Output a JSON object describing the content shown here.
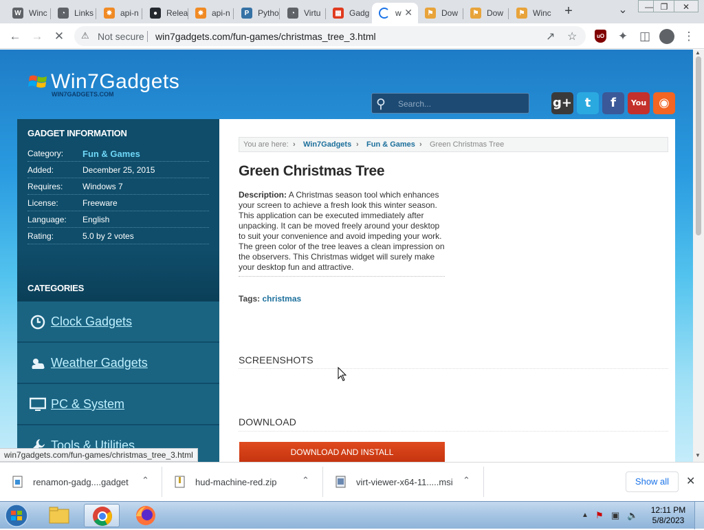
{
  "browser": {
    "tabs": [
      {
        "label": "Winc",
        "color": "#5f6368",
        "glyph": "W"
      },
      {
        "label": "Links",
        "color": "#5f6368",
        "glyph": "◔"
      },
      {
        "label": "api-n",
        "color": "#f08a24",
        "glyph": "✸"
      },
      {
        "label": "Relea",
        "color": "#24292f",
        "glyph": "●"
      },
      {
        "label": "api-n",
        "color": "#f08a24",
        "glyph": "✸"
      },
      {
        "label": "Pytho",
        "color": "#3572a5",
        "glyph": "P"
      },
      {
        "label": "Virtu",
        "color": "#5f6368",
        "glyph": "◔"
      },
      {
        "label": "Gadg",
        "color": "#e03a1e",
        "glyph": "▦"
      },
      {
        "label": "w",
        "color": "#1a73e8",
        "glyph": ""
      },
      {
        "label": "Dow",
        "color": "#e8a33a",
        "glyph": "⚑"
      },
      {
        "label": "Dow",
        "color": "#e8a33a",
        "glyph": "⚑"
      },
      {
        "label": "Winc",
        "color": "#e8a33a",
        "glyph": "⚑"
      }
    ],
    "new_tab": "+",
    "tab_menu": "⌄",
    "window": {
      "minimize": "—",
      "restore": "❐",
      "close": "✕"
    },
    "nav": {
      "back": "←",
      "forward": "→",
      "stop": "✕"
    },
    "security": "Not secure",
    "url": "win7gadgets.com/fun-games/christmas_tree_3.html"
  },
  "site": {
    "logo": "Win7Gadgets",
    "logo_sub": "WIN7GADGETS.COM",
    "search_placeholder": "Search...",
    "social": [
      {
        "name": "google-plus",
        "glyph": "g+",
        "color": "#3a3a3a"
      },
      {
        "name": "twitter",
        "glyph": "t",
        "color": "#2aa9e0"
      },
      {
        "name": "facebook",
        "glyph": "f",
        "color": "#3b5998"
      },
      {
        "name": "youtube",
        "glyph": "You",
        "color": "#c4302b"
      },
      {
        "name": "rss",
        "glyph": "◉",
        "color": "#f26522"
      }
    ]
  },
  "sidebar": {
    "info_heading": "GADGET INFORMATION",
    "info": [
      {
        "label": "Category:",
        "value": "Fun & Games",
        "link": true
      },
      {
        "label": "Added:",
        "value": "December 25, 2015",
        "link": false
      },
      {
        "label": "Requires:",
        "value": "Windows 7",
        "link": false
      },
      {
        "label": "License:",
        "value": "Freeware",
        "link": false
      },
      {
        "label": "Language:",
        "value": "English",
        "link": false
      },
      {
        "label": "Rating:",
        "value": " 5.0 by 2 votes",
        "link": false
      }
    ],
    "categories_heading": "CATEGORIES",
    "categories": [
      {
        "label": "Clock Gadgets",
        "icon": "clock-icon"
      },
      {
        "label": "Weather Gadgets",
        "icon": "weather-icon"
      },
      {
        "label": "PC & System",
        "icon": "monitor-icon"
      },
      {
        "label": "Tools & Utilities",
        "icon": "wrench-icon"
      }
    ]
  },
  "content": {
    "breadcrumb": {
      "prefix": "You are here:",
      "items": [
        "Win7Gadgets",
        "Fun & Games"
      ],
      "current": "Green Christmas Tree"
    },
    "title": "Green Christmas Tree",
    "description_label": "Description:",
    "description": "A Christmas season tool which enhances your screen to achieve a fresh look this winter season. This application can be executed immediately after unpacking. It can be moved freely around your desktop to suit your convenience and avoid impeding your work. The green color of the tree leaves a clean impression on the observers. This Christmas widget will surely make your desktop fun and attractive.",
    "tags_label": "Tags:",
    "tags_value": "christmas",
    "screenshots_heading": "SCREENSHOTS",
    "download_heading": "DOWNLOAD",
    "download_button": "DOWNLOAD AND INSTALL"
  },
  "status_url": "win7gadgets.com/fun-games/christmas_tree_3.html",
  "downloads": {
    "items": [
      {
        "name": "renamon-gadg....gadget"
      },
      {
        "name": "hud-machine-red.zip"
      },
      {
        "name": "virt-viewer-x64-11.....msi"
      }
    ],
    "caret": "⌃",
    "show_all": "Show all",
    "close": "✕"
  },
  "taskbar": {
    "time": "12:11 PM",
    "date": "5/8/2023"
  }
}
